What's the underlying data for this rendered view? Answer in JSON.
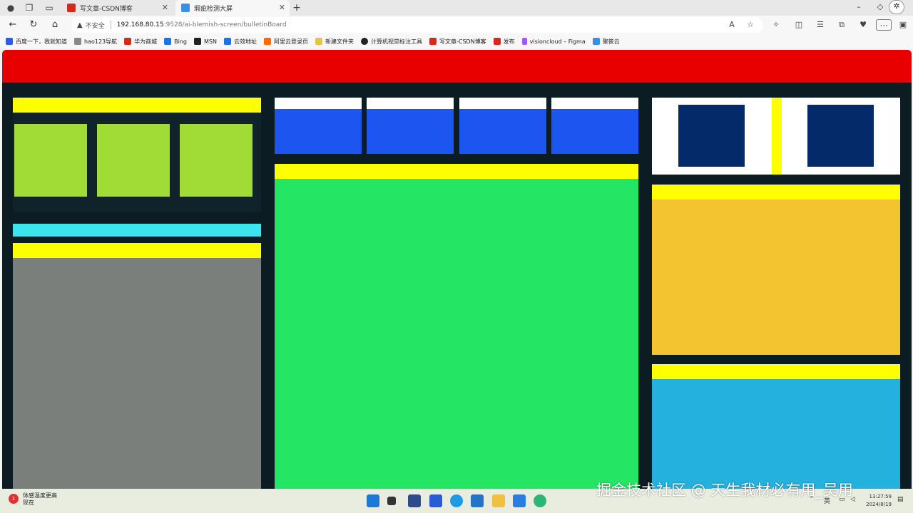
{
  "browser": {
    "tabs": [
      {
        "label": "写文章-CSDN博客",
        "active": false,
        "favicon_color": "#d42a1a"
      },
      {
        "label": "瑕疵检测大屏",
        "active": true,
        "favicon_color": "#3a8ee6"
      }
    ],
    "new_tab": "+",
    "address": {
      "security_label": "不安全",
      "host": "192.168.80.15",
      "path": ":9528/ai-blemish-screen/bulletinBoard"
    },
    "bookmarks": [
      {
        "label": "百度一下，我就知道",
        "icon_color": "#2e5ce6"
      },
      {
        "label": "hao123导航",
        "icon_color": "#888888"
      },
      {
        "label": "华为商城",
        "icon_color": "#d42a1a"
      },
      {
        "label": "Bing",
        "icon_color": "#1a73e8"
      },
      {
        "label": "MSN",
        "icon_color": "#222222"
      },
      {
        "label": "云效地址",
        "icon_color": "#1a73e8"
      },
      {
        "label": "阿里云登录页",
        "icon_color": "#ff6a00"
      },
      {
        "label": "新建文件夹",
        "icon_color": "#e8c34a"
      },
      {
        "label": "计算机视觉标注工具",
        "icon_color": "#222222"
      },
      {
        "label": "写文章-CSDN博客",
        "icon_color": "#d42a1a"
      },
      {
        "label": "发布",
        "icon_color": "#d42a1a"
      },
      {
        "label": "visioncloud – Figma",
        "icon_color": "#a259ff"
      },
      {
        "label": "聚筱云",
        "icon_color": "#3a8ee6"
      }
    ]
  },
  "dashboard": {
    "colors": {
      "background": "#0b1d22",
      "header": "#e80000",
      "title_strip": "#ffff00",
      "left_tiles": "#a0dc35",
      "cyan_strip": "#3ce4ee",
      "gray_panel": "#7b7f7c",
      "kpi_label": "#ffffff",
      "kpi_value": "#1c55f0",
      "green_panel": "#25e565",
      "right_card": "#ffffff",
      "right_squares": "#042a6a",
      "orange_panel": "#f4c430",
      "blue_panel": "#25b1dd"
    }
  },
  "taskbar": {
    "weather_title": "体感温度更高",
    "weather_sub": "现在",
    "weather_badge": "1",
    "ime": "英",
    "time": "13:27:59",
    "date": "2024/8/19"
  },
  "watermark": "掘金技术社区 @ 天生我材必有用_吴用"
}
